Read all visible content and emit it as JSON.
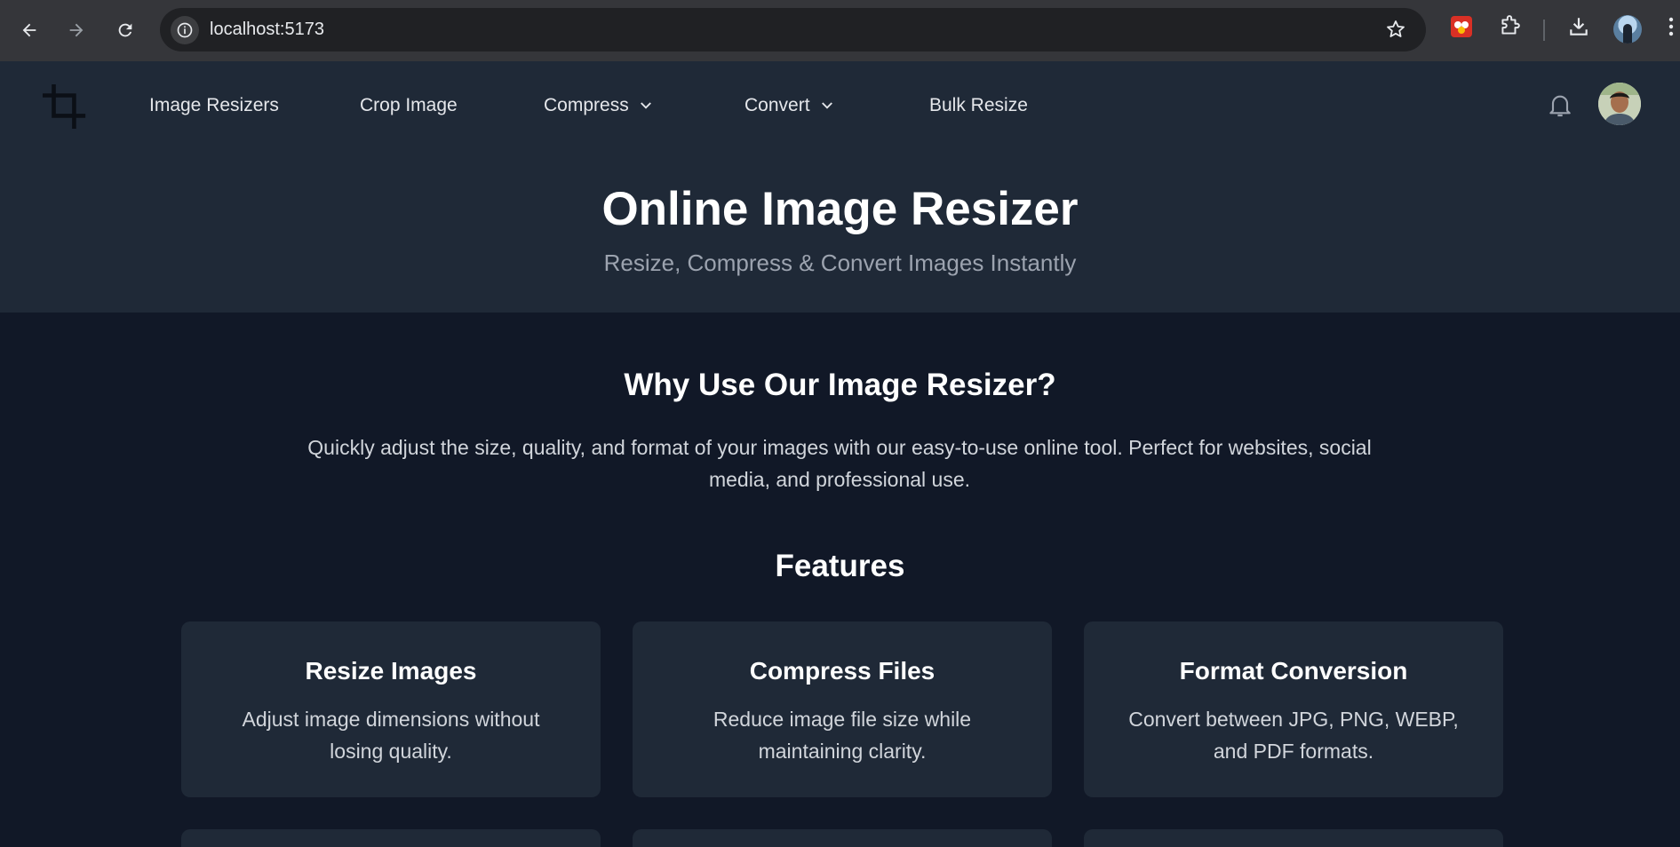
{
  "browser": {
    "url": "localhost:5173"
  },
  "nav": {
    "items": [
      {
        "label": "Image Resizers"
      },
      {
        "label": "Crop Image"
      },
      {
        "label": "Compress"
      },
      {
        "label": "Convert"
      },
      {
        "label": "Bulk Resize"
      }
    ]
  },
  "hero": {
    "title": "Online Image Resizer",
    "subtitle": "Resize, Compress & Convert Images Instantly"
  },
  "why": {
    "title": "Why Use Our Image Resizer?",
    "text": "Quickly adjust the size, quality, and format of your images with our easy-to-use online tool. Perfect for websites, social media, and professional use."
  },
  "features": {
    "title": "Features",
    "cards": [
      {
        "title": "Resize Images",
        "text": "Adjust image dimensions without losing quality."
      },
      {
        "title": "Compress Files",
        "text": "Reduce image file size while maintaining clarity."
      },
      {
        "title": "Format Conversion",
        "text": "Convert between JPG, PNG, WEBP, and PDF formats."
      }
    ]
  },
  "colors": {
    "header_bg": "#1f2937",
    "page_bg": "#111827",
    "card_bg": "#1f2937",
    "subtitle": "#9ca3af"
  }
}
